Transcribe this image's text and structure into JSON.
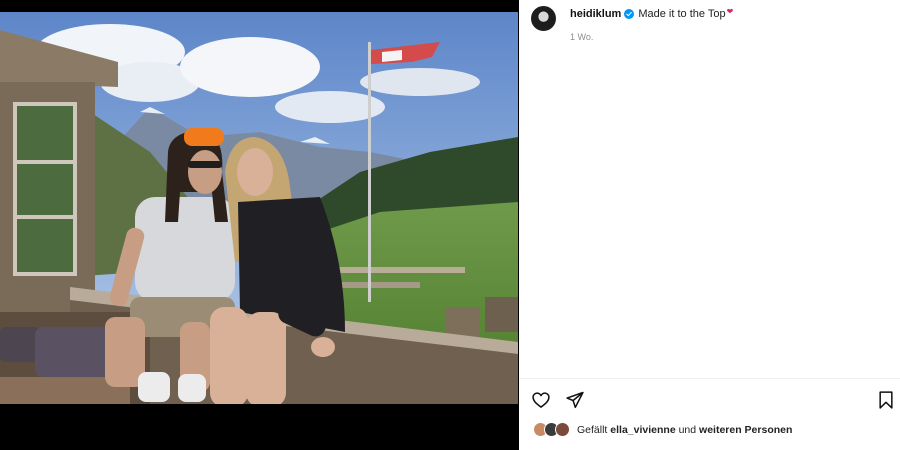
{
  "post": {
    "username": "heidiklum",
    "caption": "Made it to the Top",
    "caption_emoji": "❤",
    "time_ago": "1 Wo."
  },
  "likes": {
    "prefix": "Gefällt",
    "first_liker": "ella_vivienne",
    "connector": "und",
    "others": "weiteren Personen"
  },
  "icons": {
    "verified": "verified-badge-icon",
    "like": "heart-icon",
    "share": "paper-plane-icon",
    "save": "bookmark-icon"
  },
  "colors": {
    "verified_blue": "#0095f6",
    "muted_text": "#8e8e8e"
  }
}
